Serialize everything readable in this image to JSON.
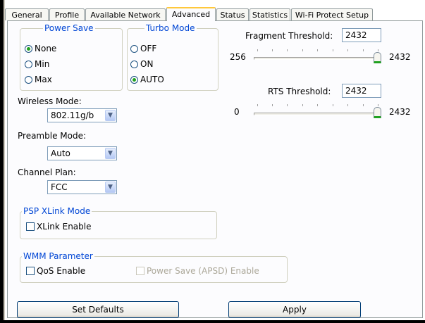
{
  "tabs": [
    {
      "label": "General"
    },
    {
      "label": "Profile"
    },
    {
      "label": "Available Network"
    },
    {
      "label": "Advanced"
    },
    {
      "label": "Status"
    },
    {
      "label": "Statistics"
    },
    {
      "label": "Wi-Fi Protect Setup"
    }
  ],
  "active_tab": "Advanced",
  "power_save": {
    "title": "Power Save",
    "options": [
      {
        "label": "None",
        "checked": true
      },
      {
        "label": "Min",
        "checked": false
      },
      {
        "label": "Max",
        "checked": false
      }
    ]
  },
  "turbo_mode": {
    "title": "Turbo Mode",
    "options": [
      {
        "label": "OFF",
        "checked": false
      },
      {
        "label": "ON",
        "checked": false
      },
      {
        "label": "AUTO",
        "checked": true
      }
    ]
  },
  "wireless_mode": {
    "label": "Wireless Mode:",
    "value": "802.11g/b"
  },
  "preamble_mode": {
    "label": "Preamble Mode:",
    "value": "Auto"
  },
  "channel_plan": {
    "label": "Channel Plan:",
    "value": "FCC"
  },
  "fragment_threshold": {
    "label": "Fragment Threshold:",
    "value": "2432",
    "min_label": "256",
    "max_label": "2432",
    "min": 256,
    "max": 2432
  },
  "rts_threshold": {
    "label": "RTS Threshold:",
    "value": "2432",
    "min_label": "0",
    "max_label": "2432",
    "min": 0,
    "max": 2432
  },
  "psp_xlink": {
    "title": "PSP XLink Mode",
    "checkbox_label": "XLink Enable",
    "checked": false
  },
  "wmm": {
    "title": "WMM Parameter",
    "qos_label": "QoS Enable",
    "qos_checked": false,
    "apsd_label": "Power Save (APSD) Enable",
    "apsd_checked": false,
    "apsd_enabled": false
  },
  "buttons": {
    "set_defaults": "Set Defaults",
    "apply": "Apply"
  },
  "colors": {
    "group_title": "#0046d5",
    "radio_dot": "#21a121",
    "active_tab_accent": "#ffc83c"
  }
}
